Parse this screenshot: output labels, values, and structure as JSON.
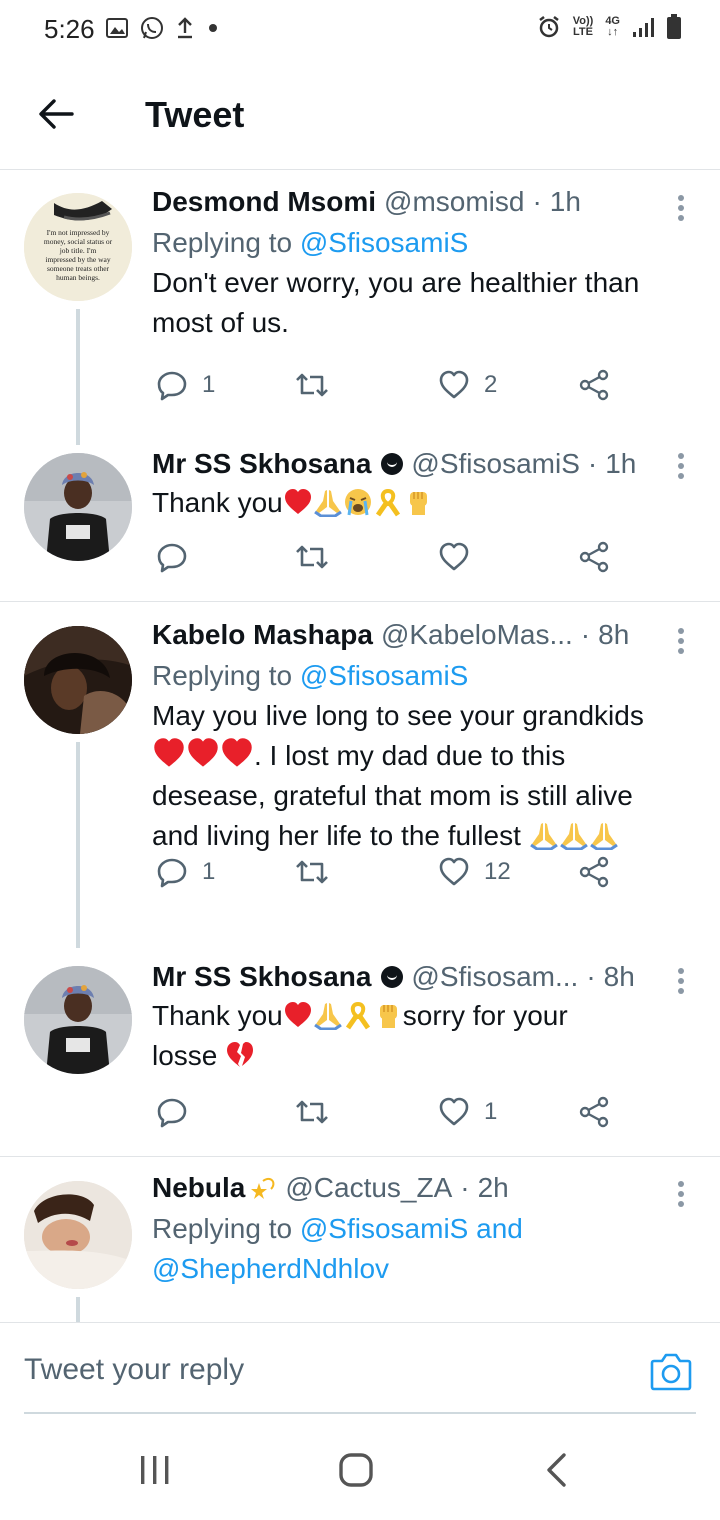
{
  "status_bar": {
    "time": "5:26",
    "left_icons": [
      "gallery-icon",
      "whatsapp-icon",
      "upload-icon",
      "dot-icon"
    ],
    "right_icons": [
      "alarm-icon",
      "volte-icon",
      "4g-icon",
      "signal-icon",
      "battery-icon"
    ],
    "volte_top": "Vo))",
    "volte_bottom": "LTE",
    "net": "4G"
  },
  "header": {
    "title": "Tweet",
    "back_icon": "arrow-left-icon"
  },
  "tweets": [
    {
      "name": "Desmond Msomi",
      "handle": "@msomisd",
      "sep": "·",
      "time": "1h",
      "replying_prefix": "Replying to",
      "replying_to": "@SfisosamiS",
      "text_line1": "Don't ever worry, you are healthier than",
      "text_line2": "most of us.",
      "replies": "1",
      "retweets": "",
      "likes": "2",
      "avatar_quote": {
        "line1": "I'm not impressed by",
        "line2": "money, social status or",
        "line3": "job title. I'm",
        "line4": "impressed by the way",
        "line5": "someone treats other",
        "line6": "human beings."
      }
    },
    {
      "name": "Mr SS Skhosana",
      "handle": "@SfisosamiS",
      "sep": "·",
      "time": "1h",
      "text": "Thank you",
      "emojis": [
        "red-heart",
        "folded-hands",
        "crying-face",
        "yellow-ribbon",
        "raised-fist"
      ],
      "replies": "",
      "likes": ""
    },
    {
      "name": "Kabelo Mashapa",
      "handle": "@KabeloMas...",
      "sep": "·",
      "time": "8h",
      "replying_prefix": "Replying to",
      "replying_to": "@SfisosamiS",
      "text_line1": "May you live long to see your grandkids",
      "text_line2": ". I lost my dad due to this",
      "text_line3": "desease, grateful that mom is still alive",
      "text_line4": "and living her life to the fullest",
      "replies": "1",
      "likes": "12"
    },
    {
      "name": "Mr SS Skhosana",
      "handle": "@Sfisosam...",
      "sep": "·",
      "time": "8h",
      "text_a": "Thank you",
      "text_b": "sorry for your",
      "text_c": "losse",
      "replies": "",
      "likes": "1"
    },
    {
      "name": "Nebula",
      "handle": "@Cactus_ZA",
      "sep": "·",
      "time": "2h",
      "replying_prefix": "Replying to",
      "replying_to": "@SfisosamiS",
      "and": "and",
      "replying_to2": "@ShepherdNdhlov"
    }
  ],
  "composer": {
    "placeholder": "Tweet your reply",
    "camera_icon": "camera-icon"
  },
  "navbar": {
    "icons": [
      "recents-icon",
      "home-icon",
      "back-icon"
    ]
  },
  "colors": {
    "accent": "#1d9bf0",
    "text": "#0f1419",
    "muted": "#536471",
    "divider": "#e1e4e7",
    "heart": "#e8202a"
  }
}
